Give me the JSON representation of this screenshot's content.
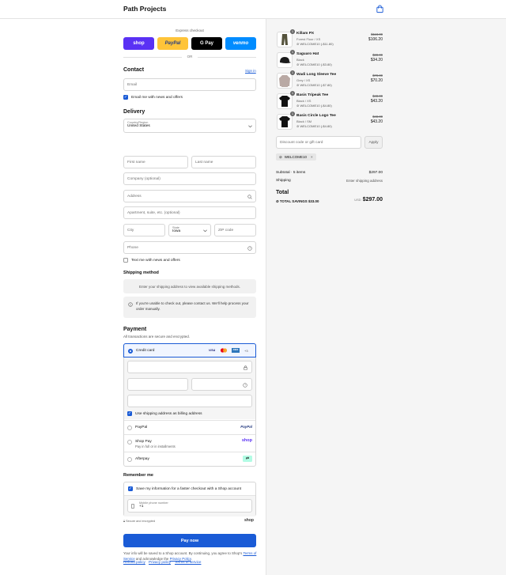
{
  "header": {
    "brand": "Path Projects",
    "cart_icon": "bag-icon"
  },
  "express": {
    "title": "Express checkout",
    "buttons": [
      {
        "label": "shop",
        "color": "#5a31f4"
      },
      {
        "label": "PayPal",
        "color": "#ffc439"
      },
      {
        "label": "G Pay",
        "color": "#000000"
      },
      {
        "label": "venmo",
        "color": "#008cff"
      }
    ],
    "or": "OR"
  },
  "contact": {
    "title": "Contact",
    "sign_in": "Sign in",
    "email_placeholder": "Email",
    "news_label": "Email me with news and offers"
  },
  "delivery": {
    "title": "Delivery",
    "country_label": "Country/Region",
    "country_value": "United States",
    "first_name": "First name",
    "last_name": "Last name",
    "company": "Company (optional)",
    "address": "Address",
    "apartment": "Apartment, suite, etc. (optional)",
    "city": "City",
    "state_label": "State",
    "state_value": "Iowa",
    "zip": "ZIP code",
    "phone": "Phone",
    "text_label": "Text me with news and offers"
  },
  "shipping": {
    "title": "Shipping method",
    "placeholder_text": "Enter your shipping address to view available shipping methods.",
    "notice": "If you're unable to check out, please contact us. We'll help process your order manually."
  },
  "payment": {
    "title": "Payment",
    "subtitle": "All transactions are secure and encrypted.",
    "credit_card": "Credit card",
    "card_logos": [
      "VISA",
      "mastercard",
      "AMEX",
      "+3"
    ],
    "billing_label": "Use shipping address as billing address",
    "paypal": "PayPal",
    "paypal_logo": "PayPal",
    "shop_pay": "Shop Pay",
    "shop_pay_sub": "Pay in full or in installments",
    "shop_pay_logo": "shop",
    "afterpay": "Afterpay"
  },
  "remember": {
    "title": "Remember me",
    "save_label": "Save my information for a faster checkout with a Shop account",
    "mobile_label": "Mobile phone number",
    "mobile_value": "+1",
    "secure": "Secure and encrypted",
    "shop_logo": "shop"
  },
  "pay_button": "Pay now",
  "legal": {
    "line1": "Your info will be saved to a Shop account. By continuing, you agree to Shop's",
    "terms": "Terms of Service",
    "and": "and acknowledge the",
    "privacy": "Privacy Policy",
    "end": "."
  },
  "footer_links": [
    "Refund policy",
    "Privacy policy",
    "Terms of service"
  ],
  "summary": {
    "items": [
      {
        "name": "Killam PX",
        "variant": "Forest Floor / XS",
        "discount": "WELCOME10 (-$11.80)",
        "old_price": "$118.00",
        "price": "$106.20",
        "qty": "1"
      },
      {
        "name": "Saguaro Hat",
        "variant": "Black",
        "discount": "WELCOME10 (-$3.80)",
        "old_price": "$38.00",
        "price": "$34.20",
        "qty": "1"
      },
      {
        "name": "Wadi Long Sleeve Tee",
        "variant": "Grey / XS",
        "discount": "WELCOME10 (-$7.80)",
        "old_price": "$78.00",
        "price": "$70.20",
        "qty": "1"
      },
      {
        "name": "Basis Tripeak Tee",
        "variant": "Black / XS",
        "discount": "WELCOME10 (-$4.80)",
        "old_price": "$48.00",
        "price": "$43.20",
        "qty": "1"
      },
      {
        "name": "Basis Circle Logo Tee",
        "variant": "Black / SM",
        "discount": "WELCOME10 (-$4.80)",
        "old_price": "$48.00",
        "price": "$43.20",
        "qty": "1"
      }
    ],
    "discount_placeholder": "Discount code or gift card",
    "apply": "Apply",
    "code_chip": "WELCOME10",
    "subtotal_label": "Subtotal · 5 items",
    "subtotal_value": "$297.00",
    "shipping_label": "Shipping",
    "shipping_value": "Enter shipping address",
    "total_label": "Total",
    "currency": "USD",
    "total_value": "$297.00",
    "savings_label": "TOTAL SAVINGS",
    "savings_value": "$33.00"
  },
  "colors": {
    "accent": "#1a5bd6",
    "border": "#d6d6d6",
    "sidebar_bg": "#f5f5f5"
  }
}
